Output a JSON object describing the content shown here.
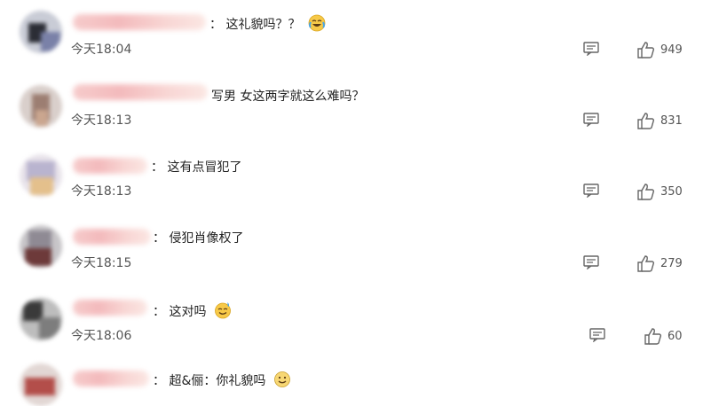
{
  "comments": [
    {
      "sep": "：",
      "text": "这礼貌吗？？",
      "emoji": "laugh-cry-emoji",
      "time": "今天18:04",
      "likes": "949"
    },
    {
      "sep": "",
      "text": "写男 女这两字就这么难吗？",
      "emoji": "",
      "time": "今天18:13",
      "likes": "831"
    },
    {
      "sep": "：",
      "text": "这有点冒犯了",
      "emoji": "",
      "time": "今天18:13",
      "likes": "350"
    },
    {
      "sep": "：",
      "text": "侵犯肖像权了",
      "emoji": "",
      "time": "今天18:15",
      "likes": "279"
    },
    {
      "sep": "：",
      "text": "这对吗",
      "emoji": "sweat-smile-emoji",
      "time": "今天18:06",
      "likes": "60"
    },
    {
      "sep": "：",
      "text": "超&俪：你礼貌吗",
      "emoji": "smile-emoji",
      "time": "",
      "likes": ""
    }
  ],
  "colors": {
    "text": "#222222",
    "meta": "#555555",
    "icon": "#666666",
    "name_blur": "#f3b7b9"
  }
}
